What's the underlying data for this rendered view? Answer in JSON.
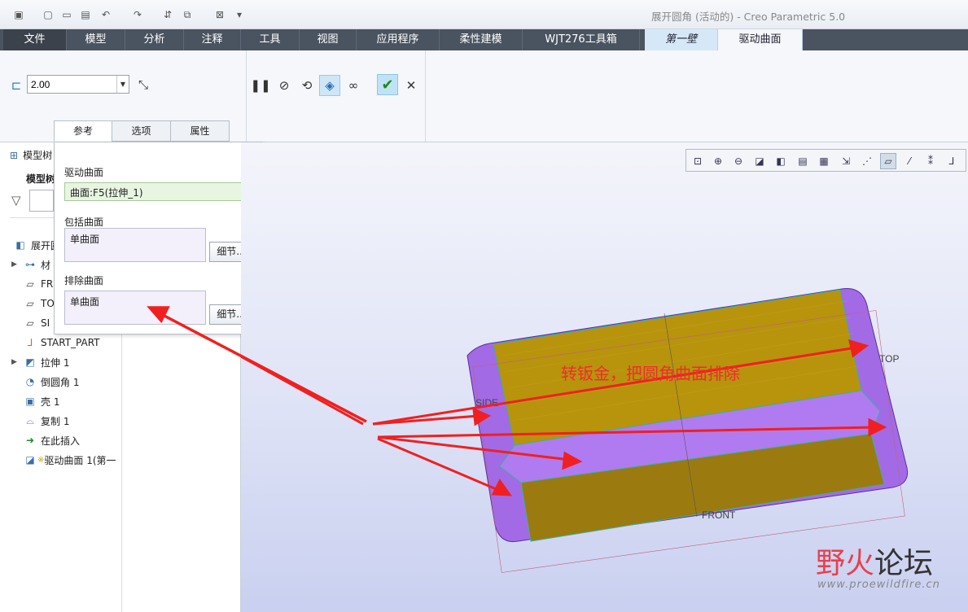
{
  "window": {
    "title": "展开圆角 (活动的) - Creo Parametric 5.0"
  },
  "tabs": [
    {
      "label": "文件"
    },
    {
      "label": "模型"
    },
    {
      "label": "分析"
    },
    {
      "label": "注释"
    },
    {
      "label": "工具"
    },
    {
      "label": "视图"
    },
    {
      "label": "应用程序"
    },
    {
      "label": "柔性建模"
    },
    {
      "label": "WJT276工具箱"
    },
    {
      "label": "第一壁"
    },
    {
      "label": "驱动曲面"
    }
  ],
  "ribbon": {
    "thickness_value": "2.00"
  },
  "subtabs": [
    {
      "label": "参考"
    },
    {
      "label": "选项"
    },
    {
      "label": "属性"
    }
  ],
  "ref_panel": {
    "drive_surface_label": "驱动曲面",
    "drive_surface_value": "曲面:F5(拉伸_1)",
    "include_label": "包括曲面",
    "include_value": "单曲面",
    "exclude_label": "排除曲面",
    "exclude_value": "单曲面",
    "detail_label": "细节..."
  },
  "model_tree": {
    "header": "模型树",
    "sub_header": "模型树",
    "items": [
      {
        "label": "展开圆",
        "icon": "part-icon"
      },
      {
        "label": "材",
        "icon": "material-icon"
      },
      {
        "label": "FR",
        "icon": "plane-icon"
      },
      {
        "label": "TO",
        "icon": "plane-icon"
      },
      {
        "label": "SI",
        "icon": "plane-icon"
      },
      {
        "label": "START_PART",
        "icon": "csys-icon"
      },
      {
        "label": "拉伸 1",
        "icon": "extrude-icon"
      },
      {
        "label": "倒圆角 1",
        "icon": "round-icon"
      },
      {
        "label": "壳 1",
        "icon": "shell-icon"
      },
      {
        "label": "复制 1",
        "icon": "copy-icon"
      },
      {
        "label": "在此插入",
        "icon": "insert-here-icon"
      },
      {
        "label": "驱动曲面 1(第一",
        "icon": "drive-surface-icon",
        "prefix": "※"
      }
    ]
  },
  "graphics": {
    "annotation": "转钣金，把圆角曲面排除",
    "datum_labels": {
      "top": "TOP",
      "front": "FRONT",
      "side": "SIDE"
    },
    "colors": {
      "yellow_face": "#b8930c",
      "purple_face": "#a36ae6",
      "arrow": "#f02020"
    }
  },
  "watermark": {
    "main": "野火",
    "sub": "论坛",
    "url": "www.proewildfire.cn"
  }
}
